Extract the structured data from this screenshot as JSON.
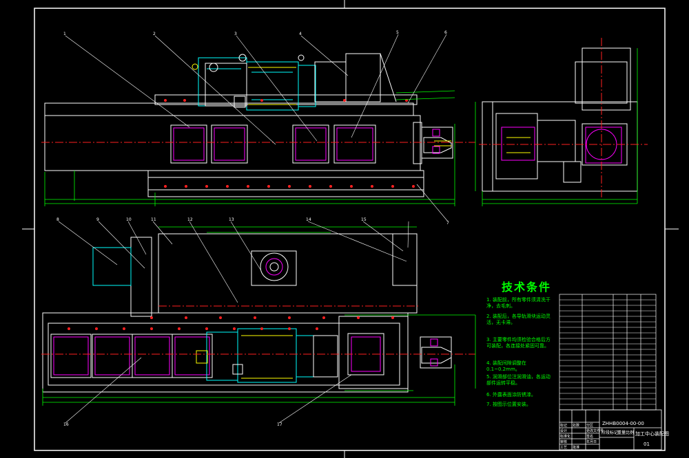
{
  "technical_requirements": {
    "title": "技术条件",
    "notes": [
      "1. 装配前，所有零件须清洗干净，去毛刺。",
      "2. 装配后，各导轨滑块运动灵活，无卡滞。",
      "3. 主要零件均须检验合格后方可装配，各连接处紧固可靠。",
      "4. 装配间隙调整在0.1~0.2mm。",
      "5. 润滑部位注润滑油，各运动部件运转平稳。",
      "6. 外露表面涂防锈漆。",
      "7. 按图示位置安装。"
    ]
  },
  "title_block": {
    "drawing_number": "ZHHB0004-00-00",
    "drawing_name": "加工中心装配图",
    "sheet": "01",
    "scale_labels": [
      "阶段标记",
      "重量",
      "比例"
    ],
    "header_labels": [
      "标记",
      "处数",
      "分区",
      "更改文件号",
      "签名",
      "年月日"
    ],
    "role_labels": [
      "设计",
      "标准化",
      "审核",
      "工艺",
      "批准"
    ]
  },
  "balloons": [
    "1",
    "2",
    "3",
    "4",
    "5",
    "6",
    "7",
    "8",
    "9",
    "10",
    "11",
    "12",
    "13",
    "14",
    "15",
    "16",
    "17"
  ],
  "colors": {
    "outline": "#ffffff",
    "centerline": "#ff2020",
    "dimension": "#00ff00",
    "motor": "#00ffff",
    "magenta": "#ff00ff",
    "yellow": "#ffff00",
    "background": "#000000"
  }
}
